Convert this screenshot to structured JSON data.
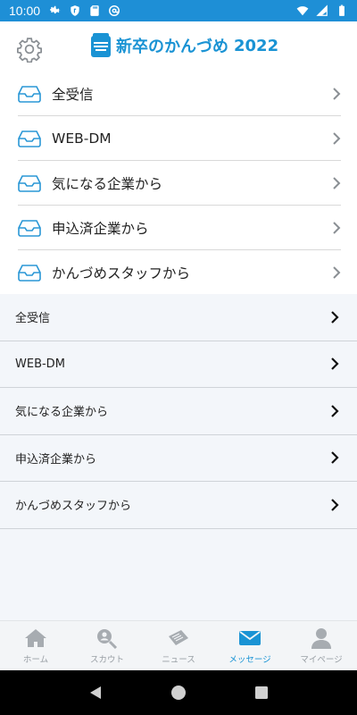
{
  "status_bar": {
    "time": "10:00",
    "left_icons": [
      "gear-icon",
      "shield-icon",
      "sd-card-icon",
      "at-icon"
    ],
    "right_icons": [
      "wifi-icon",
      "signal-icon",
      "battery-icon"
    ]
  },
  "header": {
    "settings_icon": "gear-icon",
    "logo_title": "新卒",
    "logo_no": "の",
    "logo_subtitle": "かんづめ",
    "logo_year": "2022"
  },
  "inbox_list": {
    "items": [
      {
        "label": "全受信",
        "icon": "inbox-icon"
      },
      {
        "label": "WEB-DM",
        "icon": "inbox-icon"
      },
      {
        "label": "気になる企業から",
        "icon": "inbox-icon"
      },
      {
        "label": "申込済企業から",
        "icon": "inbox-icon"
      },
      {
        "label": "かんづめスタッフから",
        "icon": "inbox-icon"
      }
    ]
  },
  "folder_list": {
    "items": [
      {
        "label": "全受信"
      },
      {
        "label": "WEB-DM"
      },
      {
        "label": "気になる企業から"
      },
      {
        "label": "申込済企業から"
      },
      {
        "label": "かんづめスタッフから"
      }
    ]
  },
  "bottom_nav": {
    "items": [
      {
        "label": "ホーム",
        "icon": "home-icon"
      },
      {
        "label": "スカウト",
        "icon": "scout-icon"
      },
      {
        "label": "ニュース",
        "icon": "news-icon"
      },
      {
        "label": "メッセージ",
        "icon": "mail-icon",
        "active": true
      },
      {
        "label": "マイページ",
        "icon": "person-icon"
      }
    ]
  },
  "colors": {
    "accent": "#1a93d4",
    "status_bar": "#1e8fd6",
    "nav_inactive": "#9aa0a6"
  }
}
